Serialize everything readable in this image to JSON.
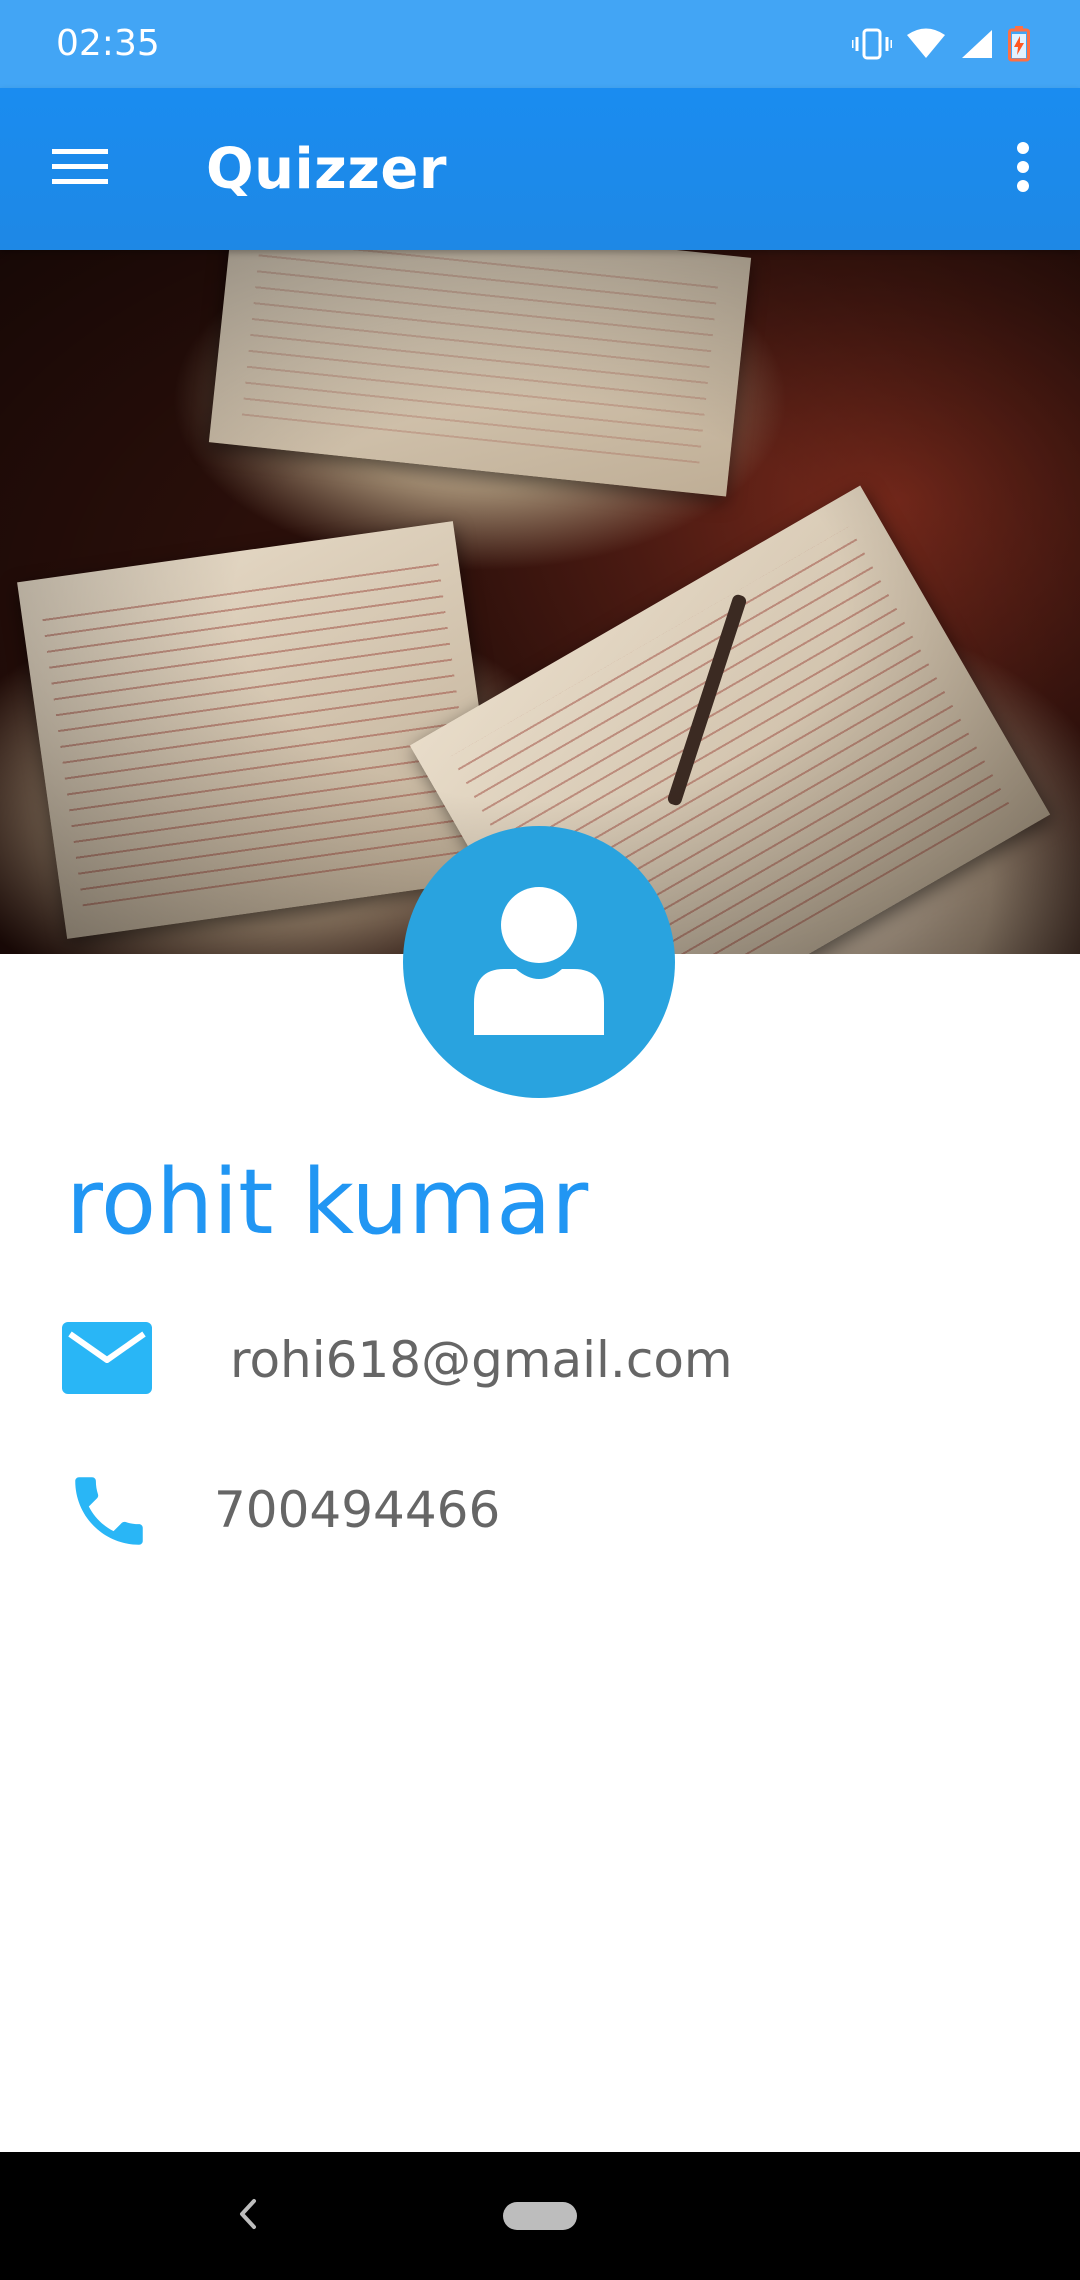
{
  "status_bar": {
    "time": "02:35",
    "icons": [
      "vibrate-icon",
      "wifi-icon",
      "signal-icon",
      "battery-charging-icon"
    ]
  },
  "app_bar": {
    "title": "Quizzer",
    "menu_icon": "hamburger-menu-icon",
    "overflow_icon": "more-vert-icon"
  },
  "profile": {
    "name": "rohit kumar",
    "email": "rohi618@gmail.com",
    "phone": "700494466",
    "avatar_icon": "person-icon",
    "email_icon": "email-icon",
    "phone_icon": "phone-icon"
  },
  "nav_bar": {
    "back_icon": "back-chevron-icon",
    "home_icon": "home-pill-icon"
  },
  "colors": {
    "status_bar": "#42a5f5",
    "app_bar": "#1e88e5",
    "accent": "#2196f3",
    "avatar": "#29a3df",
    "secondary_text": "#666666"
  }
}
